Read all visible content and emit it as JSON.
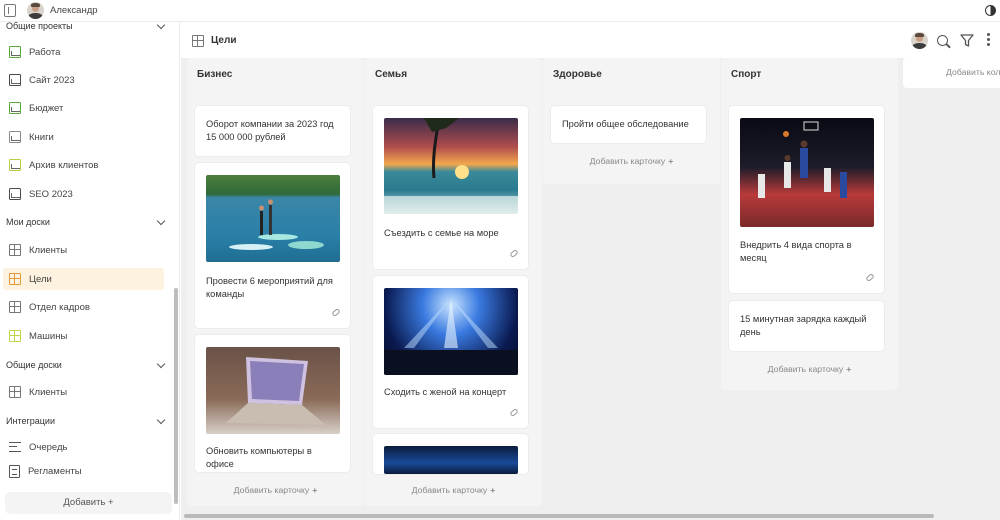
{
  "topbar": {
    "user_name": "Александр"
  },
  "sidebar": {
    "cut_section_label": "Общие проекты",
    "projects": [
      {
        "label": "Работа",
        "icon": "project-icon"
      },
      {
        "label": "Сайт 2023",
        "icon": "project-icon"
      },
      {
        "label": "Бюджет",
        "icon": "project-icon"
      },
      {
        "label": "Книги",
        "icon": "project-icon"
      },
      {
        "label": "Архив клиентов",
        "icon": "project-icon"
      },
      {
        "label": "SEO 2023",
        "icon": "project-icon"
      }
    ],
    "my_boards_label": "Мои доски",
    "my_boards": [
      {
        "label": "Клиенты"
      },
      {
        "label": "Цели"
      },
      {
        "label": "Отдел кадров"
      },
      {
        "label": "Машины"
      }
    ],
    "shared_boards_label": "Общие доски",
    "shared_boards": [
      {
        "label": "Клиенты"
      }
    ],
    "integrations_label": "Интеграции",
    "integrations": [
      {
        "label": "Очередь"
      },
      {
        "label": "Регламенты"
      }
    ],
    "add_label": "Добавить",
    "add_plus": "+"
  },
  "board": {
    "title": "Цели",
    "add_column_label": "Добавить колонку",
    "columns": [
      {
        "title": "Бизнес",
        "cards": [
          {
            "text": "Оборот компании за 2023 год 15 000 000 рублей"
          },
          {
            "text": "Провести 6 мероприятий для команды",
            "image": "paddleboard-photo"
          },
          {
            "text": "Обновить компьютеры в офисе",
            "image": "laptop-photo"
          }
        ],
        "add_card_label": "Добавить карточку"
      },
      {
        "title": "Семья",
        "cards": [
          {
            "text": "Съездить с семье на море",
            "image": "sea-sunset-photo"
          },
          {
            "text": "Сходить с женой на концерт",
            "image": "concert-photo"
          },
          {
            "text": "",
            "image": "stage-photo"
          }
        ],
        "add_card_label": "Добавить карточку"
      },
      {
        "title": "Здоровье",
        "cards": [
          {
            "text": "Пройти общее обследование"
          }
        ],
        "add_card_label": "Добавить карточку"
      },
      {
        "title": "Спорт",
        "cards": [
          {
            "text": "Внедрить 4 вида спорта в месяц",
            "image": "basketball-photo"
          },
          {
            "text": "15 минутная зарядка каждый день"
          }
        ],
        "add_card_label": "Добавить карточку"
      }
    ]
  }
}
